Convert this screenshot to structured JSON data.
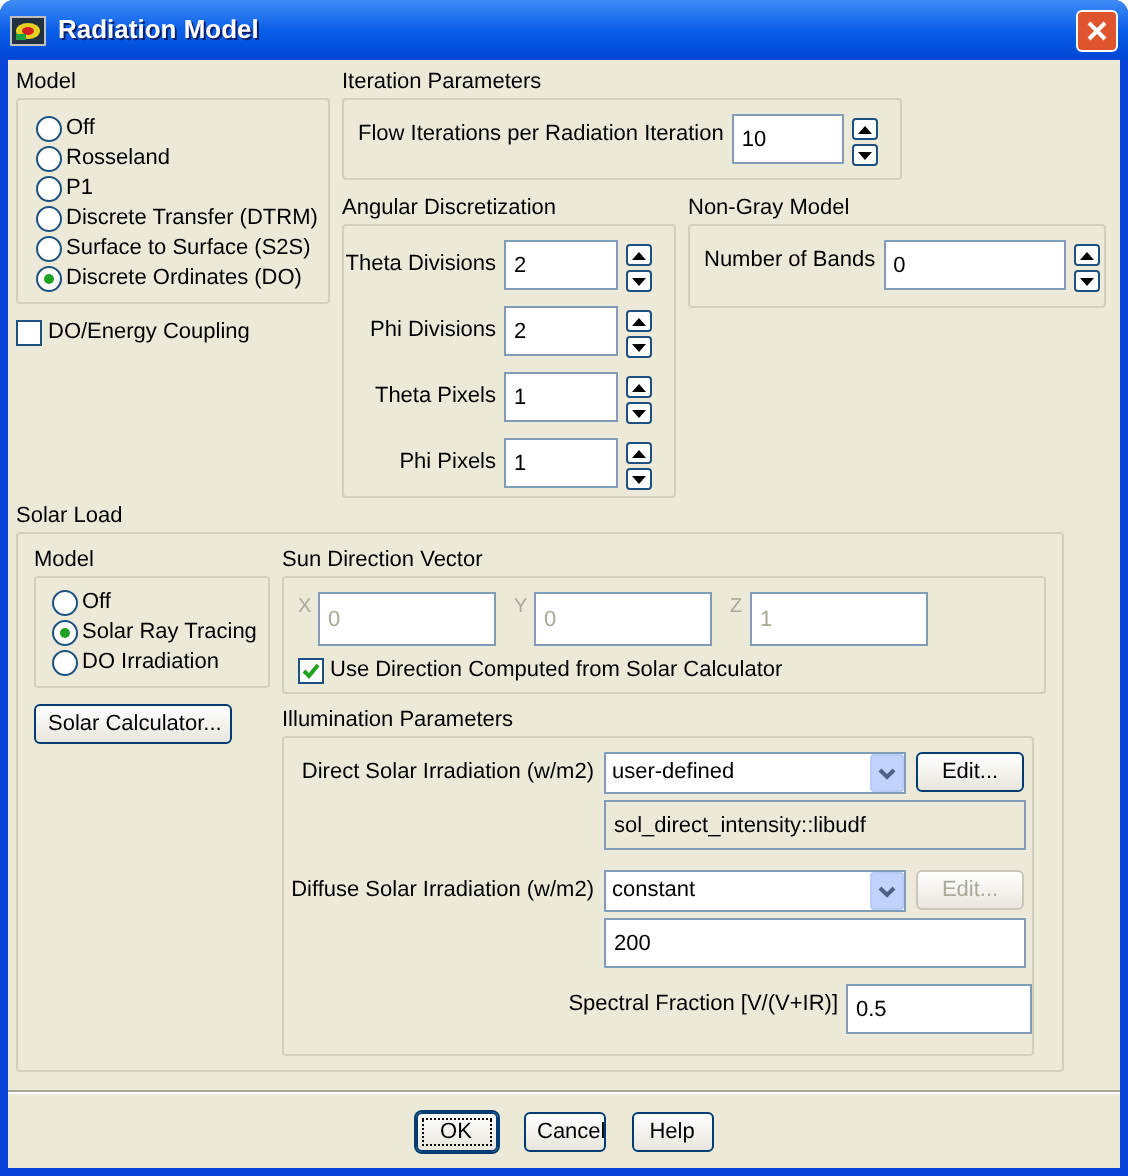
{
  "window": {
    "title": "Radiation Model"
  },
  "model": {
    "title": "Model",
    "options": [
      {
        "label": "Off",
        "selected": false
      },
      {
        "label": "Rosseland",
        "selected": false
      },
      {
        "label": "P1",
        "selected": false
      },
      {
        "label": "Discrete Transfer (DTRM)",
        "selected": false
      },
      {
        "label": "Surface to Surface (S2S)",
        "selected": false
      },
      {
        "label": "Discrete Ordinates (DO)",
        "selected": true
      }
    ]
  },
  "do_energy_coupling": {
    "label": "DO/Energy Coupling",
    "checked": false
  },
  "iteration_parameters": {
    "title": "Iteration Parameters",
    "fields": [
      {
        "label": "Flow Iterations per Radiation Iteration",
        "value": "10"
      }
    ]
  },
  "angular_discretization": {
    "title": "Angular Discretization",
    "fields": [
      {
        "label": "Theta Divisions",
        "value": "2"
      },
      {
        "label": "Phi Divisions",
        "value": "2"
      },
      {
        "label": "Theta Pixels",
        "value": "1"
      },
      {
        "label": "Phi Pixels",
        "value": "1"
      }
    ]
  },
  "non_gray_model": {
    "title": "Non-Gray Model",
    "fields": [
      {
        "label": "Number of Bands",
        "value": "0"
      }
    ]
  },
  "solar_load": {
    "title": "Solar Load",
    "model": {
      "title": "Model",
      "options": [
        {
          "label": "Off",
          "selected": false
        },
        {
          "label": "Solar Ray Tracing",
          "selected": true
        },
        {
          "label": "DO Irradiation",
          "selected": false
        }
      ]
    },
    "solar_calculator_button": "Solar Calculator...",
    "sun_direction_vector": {
      "title": "Sun Direction Vector",
      "components": [
        {
          "label": "X",
          "value": "0",
          "disabled": true
        },
        {
          "label": "Y",
          "value": "0",
          "disabled": true
        },
        {
          "label": "Z",
          "value": "1",
          "disabled": true
        }
      ],
      "use_calculator": {
        "label": "Use Direction Computed from Solar Calculator",
        "checked": true
      }
    },
    "illumination_parameters": {
      "title": "Illumination Parameters",
      "direct": {
        "label": "Direct Solar Irradiation (w/m2)",
        "method": "user-defined",
        "edit": {
          "label": "Edit...",
          "disabled": false
        },
        "value": "sol_direct_intensity::libudf",
        "readonly": true
      },
      "diffuse": {
        "label": "Diffuse Solar Irradiation (w/m2)",
        "method": "constant",
        "edit": {
          "label": "Edit...",
          "disabled": true
        },
        "value": "200",
        "readonly": false
      },
      "spectral_fraction": {
        "label": "Spectral Fraction [V/(V+IR)]",
        "value": "0.5"
      }
    }
  },
  "buttons": [
    {
      "label": "OK",
      "default": true
    },
    {
      "label": "Cancel",
      "default": false
    },
    {
      "label": "Help",
      "default": false
    }
  ]
}
